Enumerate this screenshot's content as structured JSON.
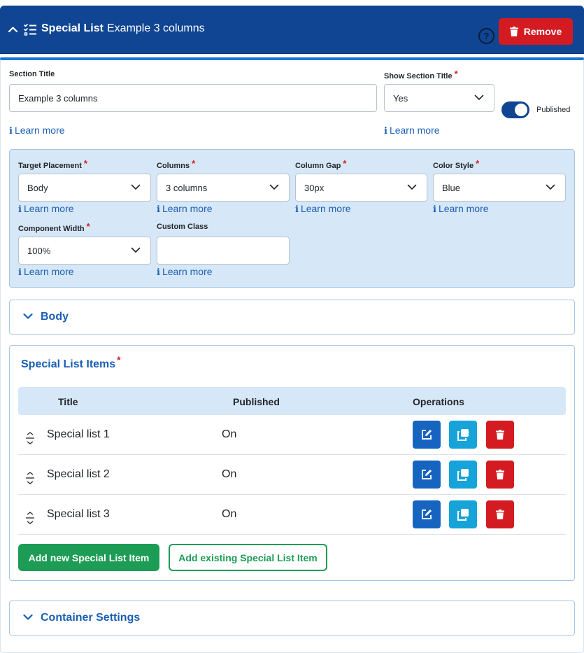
{
  "header": {
    "title_strong": "Special List",
    "title_rest": "Example 3 columns",
    "help_label": "?",
    "remove_label": "Remove",
    "colors": {
      "bar": "#0f4592",
      "remove": "#d41b22"
    }
  },
  "section": {
    "title_label": "Section Title",
    "title_value": "Example 3 columns",
    "show_title_label": "Show Section Title",
    "show_title_value": "Yes",
    "published_label": "Published",
    "published_on": true,
    "required_mark": "*"
  },
  "learn_more": "Learn more",
  "info_glyph": "ℹ",
  "settings": {
    "target_label": "Target Placement",
    "target_value": "Body",
    "columns_label": "Columns",
    "columns_value": "3 columns",
    "gap_label": "Column Gap",
    "gap_value": "30px",
    "color_label": "Color Style",
    "color_value": "Blue",
    "width_label": "Component Width",
    "width_value": "100%",
    "class_label": "Custom Class",
    "class_value": ""
  },
  "body_accordion": {
    "title": "Body"
  },
  "items": {
    "title": "Special List Items",
    "columns": {
      "title": "Title",
      "published": "Published",
      "operations": "Operations"
    },
    "rows": [
      {
        "title": "Special list 1",
        "published": "On"
      },
      {
        "title": "Special list 2",
        "published": "On"
      },
      {
        "title": "Special list 3",
        "published": "On"
      }
    ],
    "add_new_label": "Add new Special List Item",
    "add_existing_label": "Add existing Special List Item",
    "colors": {
      "edit": "#1664c0",
      "duplicate": "#16a3d9",
      "delete": "#d41b22",
      "add": "#1d9c55"
    }
  },
  "container_accordion": {
    "title": "Container Settings"
  }
}
